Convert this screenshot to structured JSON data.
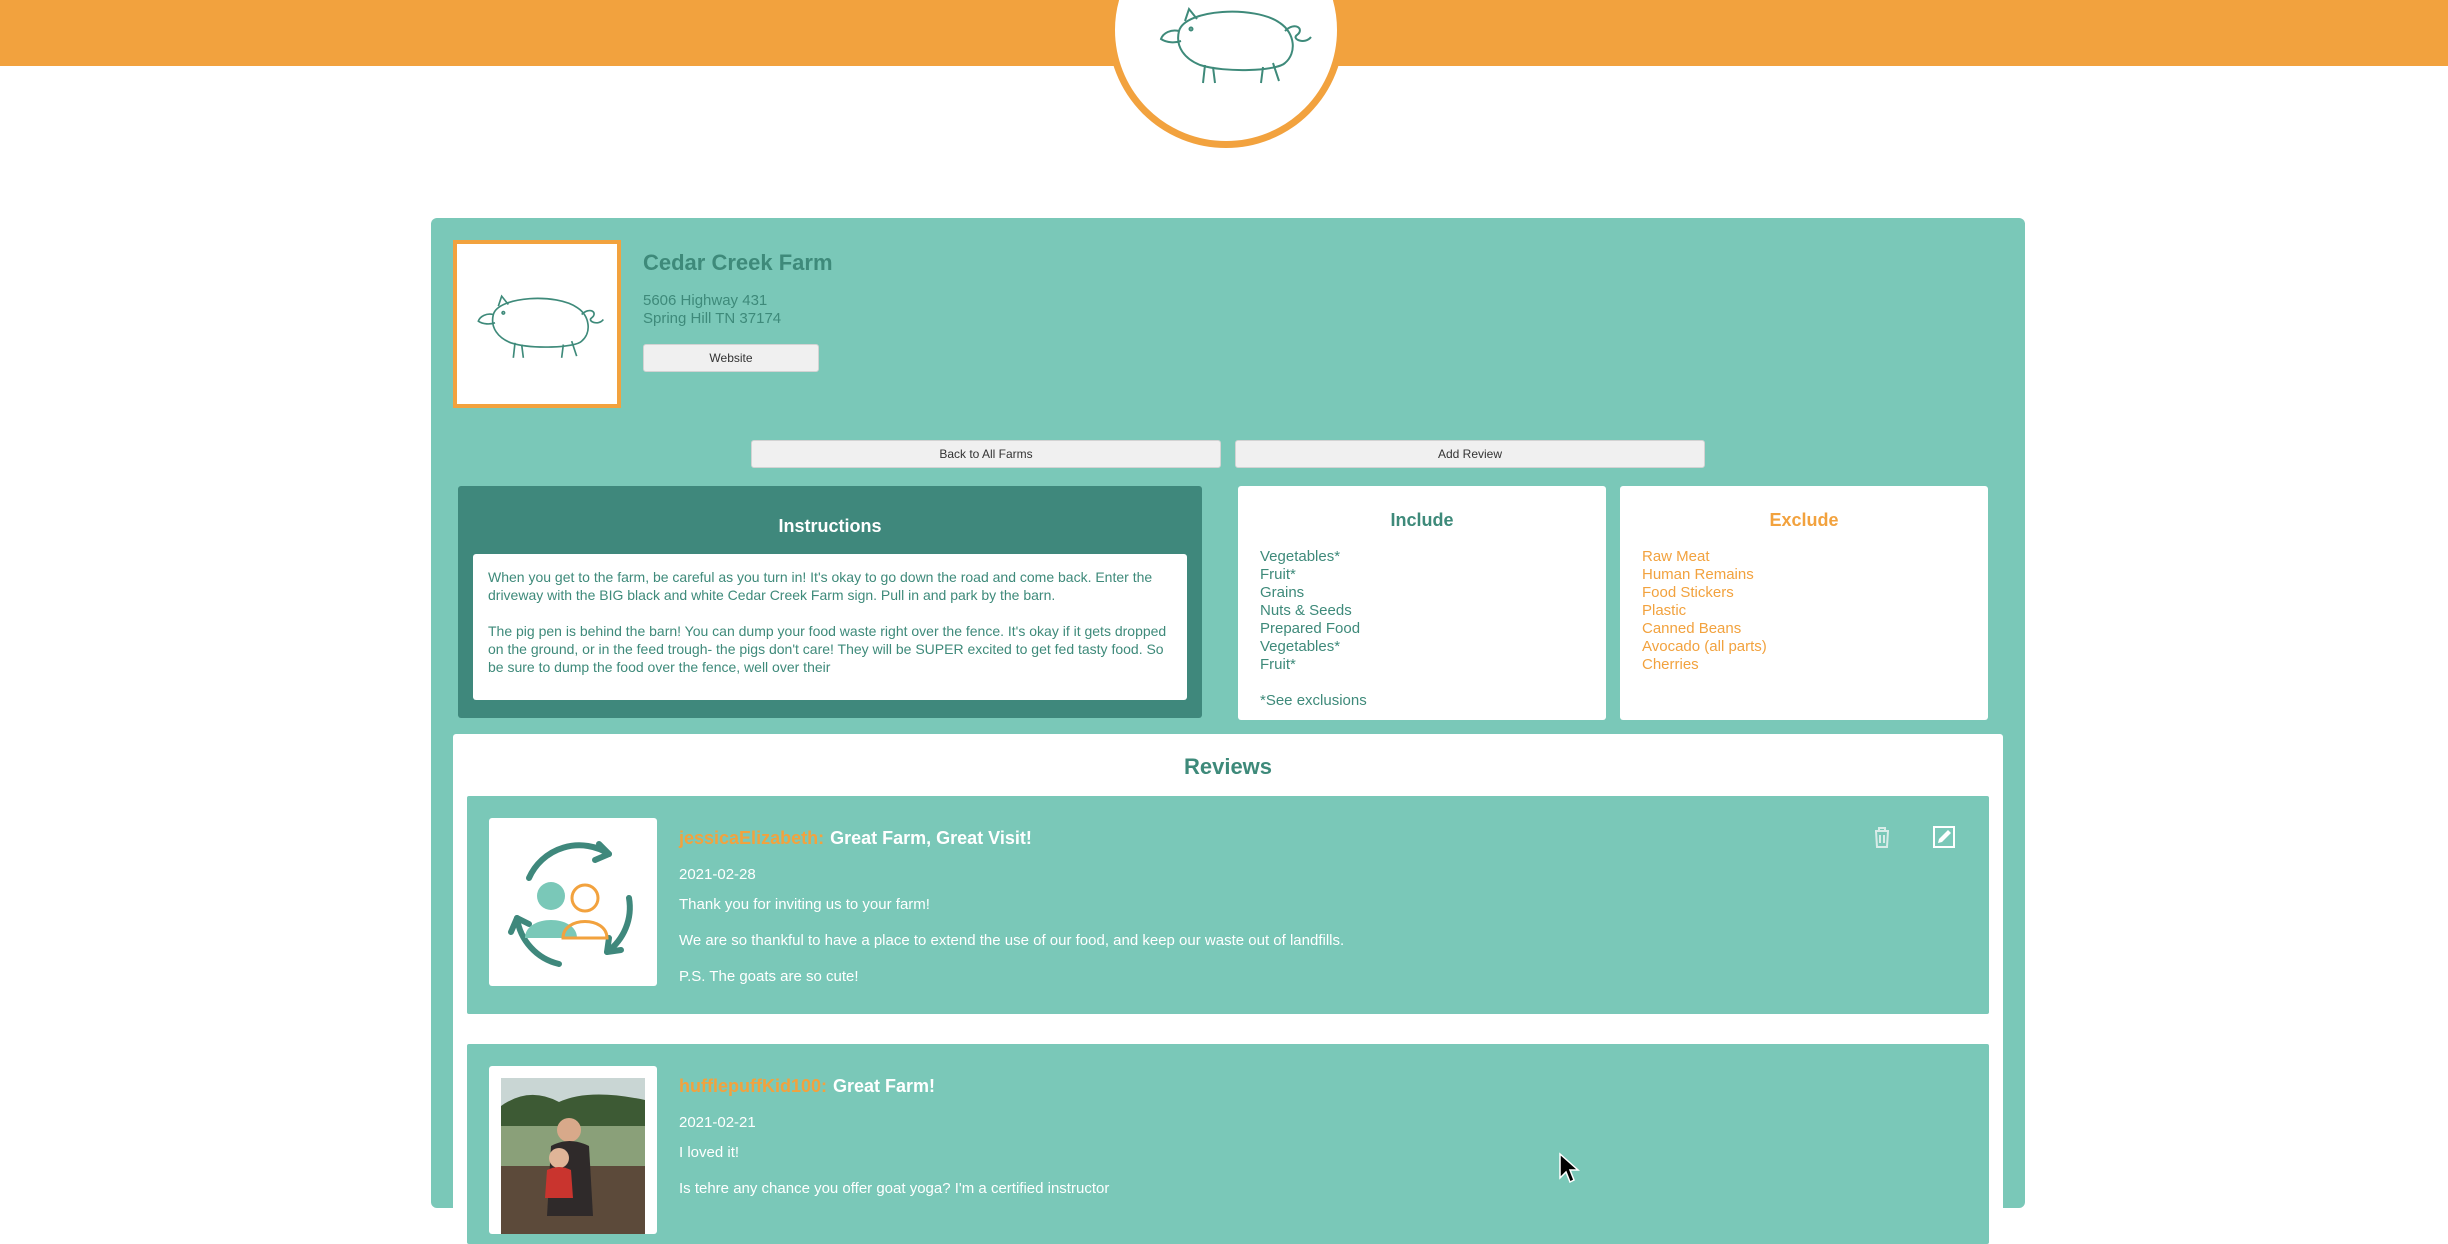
{
  "header": {
    "logo_icon": "pig-icon",
    "bar_color": "#f2a23e"
  },
  "farm": {
    "name": "Cedar Creek Farm",
    "address_line1": "5606 Highway 431",
    "address_line2": "Spring Hill TN 37174",
    "website_label": "Website",
    "image_icon": "pig-icon"
  },
  "nav": {
    "back_label": "Back to All Farms",
    "add_review_label": "Add Review"
  },
  "instructions": {
    "title": "Instructions",
    "paragraphs": [
      "When you get to the farm, be careful as you turn in! It's okay to go down the road and come back. Enter the driveway with the BIG black and white Cedar Creek Farm sign. Pull in and park by the barn.",
      "The pig pen is behind the barn! You can dump your food waste right over the fence. It's okay if it gets dropped on the ground, or in the feed trough- the pigs don't care! They will be SUPER excited to get fed tasty food. So be sure to dump the food over the fence, well over their"
    ]
  },
  "include": {
    "title": "Include",
    "items": [
      "Vegetables*",
      "Fruit*",
      "Grains",
      "Nuts & Seeds",
      "Prepared Food",
      "Vegetables*",
      "Fruit*"
    ],
    "note": "*See exclusions"
  },
  "exclude": {
    "title": "Exclude",
    "items": [
      "Raw Meat",
      "Human Remains",
      "Food Stickers",
      "Plastic",
      "Canned Beans",
      "Avocado (all parts)",
      "Cherries"
    ]
  },
  "reviews": {
    "title": "Reviews",
    "items": [
      {
        "user": "jessicaElizabeth:",
        "title": "Great Farm, Great Visit!",
        "date": "2021-02-28",
        "paragraphs": [
          "Thank you for inviting us to your farm!",
          "We are so thankful to have a place to extend the use of our food, and keep our waste out of landfills.",
          "P.S. The goats are so cute!"
        ],
        "avatar_icon": "recycle-people-icon"
      },
      {
        "user": "hufflepuffKid100:",
        "title": "Great Farm!",
        "date": "2021-02-21",
        "paragraphs": [
          "I loved it!",
          "Is tehre any chance you offer goat yoga? I'm a certified instructor"
        ],
        "avatar_icon": "photo-avatar"
      }
    ]
  },
  "colors": {
    "orange": "#f2a23e",
    "teal": "#7ac8b8",
    "dark_teal": "#3f887c",
    "text_teal": "#3e8a7a"
  }
}
